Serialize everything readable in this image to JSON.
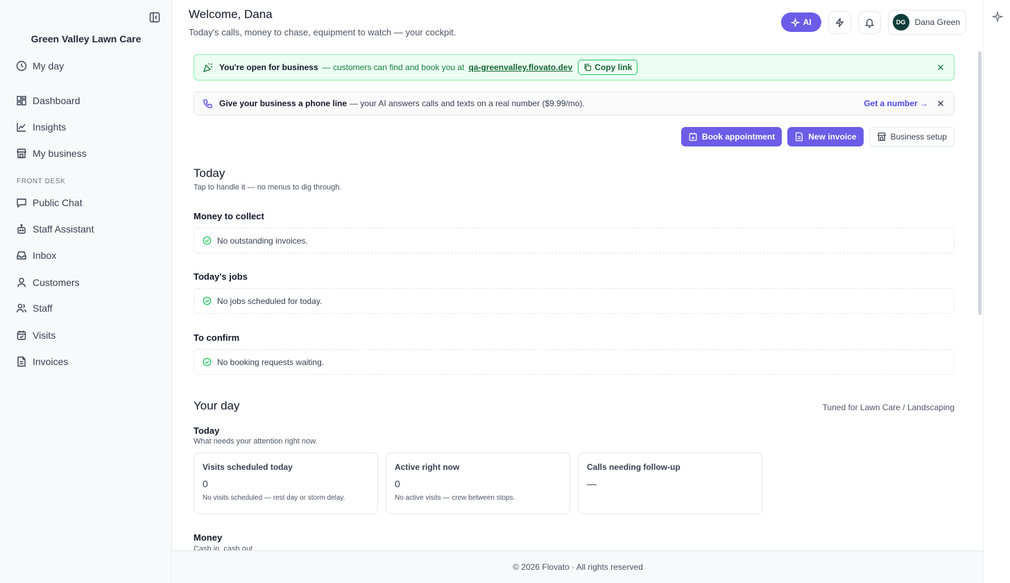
{
  "brand": {
    "name": "Green Valley Lawn Care"
  },
  "sidebar": {
    "items": [
      {
        "label": "My day",
        "icon": "clock-icon"
      },
      {
        "label": "Dashboard",
        "icon": "dashboard-icon"
      },
      {
        "label": "Insights",
        "icon": "chart-line-icon"
      },
      {
        "label": "My business",
        "icon": "store-icon"
      },
      {
        "label": "Public Chat",
        "icon": "chat-icon"
      },
      {
        "label": "Staff Assistant",
        "icon": "bot-icon"
      },
      {
        "label": "Inbox",
        "icon": "inbox-icon"
      },
      {
        "label": "Customers",
        "icon": "user-icon"
      },
      {
        "label": "Staff",
        "icon": "users-icon"
      },
      {
        "label": "Visits",
        "icon": "calendar-check-icon"
      },
      {
        "label": "Invoices",
        "icon": "file-icon"
      }
    ],
    "section_front_desk": "FRONT DESK"
  },
  "header": {
    "welcome": "Welcome, Dana",
    "subtitle": "Today's calls, money to chase, equipment to watch — your cockpit.",
    "ai_label": "AI",
    "user_initials": "DG",
    "user_name": "Dana Green"
  },
  "banners": {
    "open": {
      "strong": "You're open for business",
      "text": "— customers can find and book you at",
      "link": "qa-greenvalley.flovato.dev",
      "copy": "Copy link"
    },
    "phone": {
      "strong": "Give your business a phone line",
      "text": "— your AI answers calls and texts on a real number ($9.99/mo).",
      "cta": "Get a number →"
    }
  },
  "actions": {
    "book": "Book appointment",
    "invoice": "New invoice",
    "setup": "Business setup"
  },
  "today": {
    "title": "Today",
    "subtitle": "Tap to handle it — no menus to dig through.",
    "money_title": "Money to collect",
    "money_empty": "No outstanding invoices.",
    "jobs_title": "Today's jobs",
    "jobs_empty": "No jobs scheduled for today.",
    "confirm_title": "To confirm",
    "confirm_empty": "No booking requests waiting."
  },
  "your_day": {
    "title": "Your day",
    "tuned": "Tuned for Lawn Care / Landscaping",
    "today_title": "Today",
    "today_sub": "What needs your attention right now.",
    "cards": [
      {
        "title": "Visits scheduled today",
        "value": "0",
        "note": "No visits scheduled — rest day or storm delay."
      },
      {
        "title": "Active right now",
        "value": "0",
        "note": "No active visits — crew between stops."
      },
      {
        "title": "Calls needing follow-up",
        "value": "—",
        "note": ""
      }
    ],
    "money_title": "Money",
    "money_sub": "Cash in, cash out"
  },
  "footer": {
    "text": "© 2026 Flovato · All rights reserved"
  },
  "colors": {
    "accent": "#6c5ce7",
    "success": "#22c55e",
    "avatar": "#0f3d3a"
  }
}
